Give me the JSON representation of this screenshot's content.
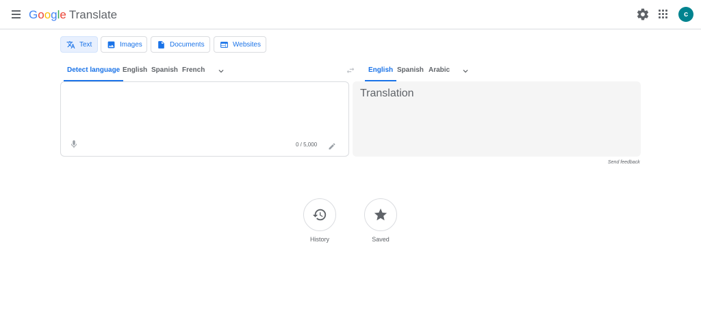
{
  "header": {
    "logo": {
      "g": "G",
      "o1": "o",
      "o2": "o",
      "g2": "g",
      "l": "l",
      "e": "e",
      "product": "Translate"
    },
    "avatar_initial": "c",
    "icons": {
      "menu": "menu-icon",
      "settings": "gear-icon",
      "apps": "apps-grid-icon"
    }
  },
  "mode_tabs": [
    {
      "label": "Text",
      "active": true
    },
    {
      "label": "Images",
      "active": false
    },
    {
      "label": "Documents",
      "active": false
    },
    {
      "label": "Websites",
      "active": false
    }
  ],
  "source_langs": [
    "Detect language",
    "English",
    "Spanish",
    "French"
  ],
  "target_langs": [
    "English",
    "Spanish",
    "Arabic"
  ],
  "source": {
    "value": "",
    "placeholder": "",
    "char_count": "0 / 5,000"
  },
  "target": {
    "placeholder": "Translation"
  },
  "feedback_label": "Send feedback",
  "actions": {
    "history": "History",
    "saved": "Saved"
  },
  "colors": {
    "accent": "#1a73e8",
    "avatar": "#00838f",
    "border": "#dadce0",
    "target_bg": "#f5f5f5"
  }
}
